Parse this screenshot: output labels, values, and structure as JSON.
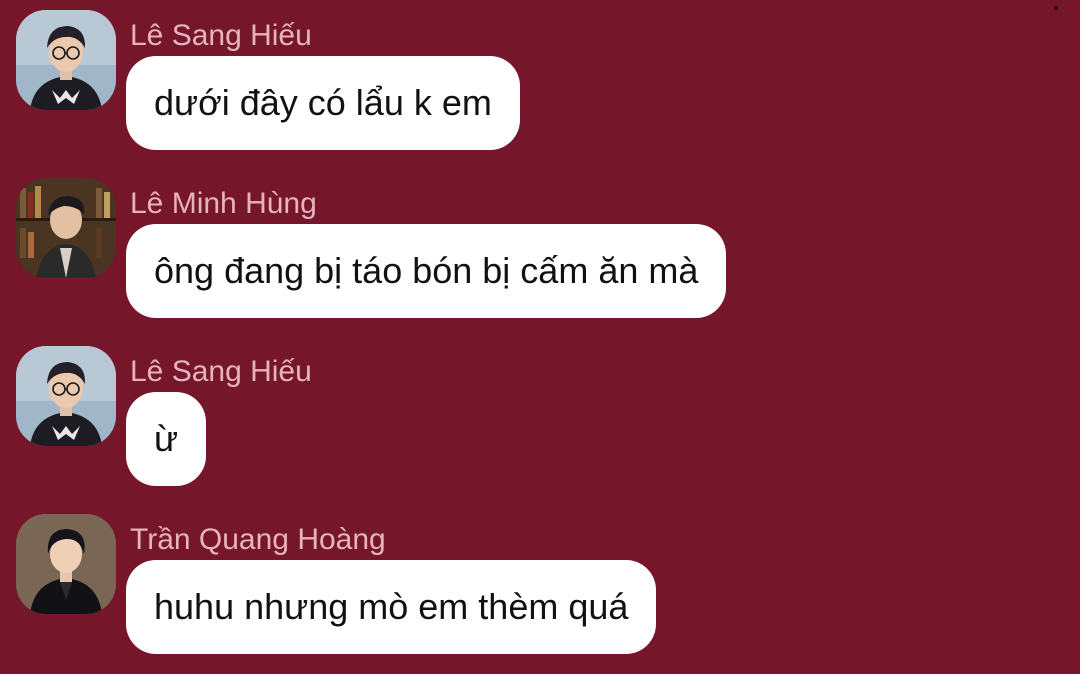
{
  "theme": {
    "background": "#75162a",
    "bubble": "#ffffff",
    "sender_color": "#e6b3bd",
    "text_color": "#111111"
  },
  "messages": [
    {
      "sender": "Lê Sang Hiếu",
      "text": "dưới đây có lẩu k em",
      "avatar": "avatar-sweater-glasses"
    },
    {
      "sender": "Lê Minh Hùng",
      "text": "ông đang bị táo bón bị cấm ăn mà",
      "avatar": "avatar-bookshelf"
    },
    {
      "sender": "Lê Sang Hiếu",
      "text": "ừ",
      "avatar": "avatar-sweater-glasses"
    },
    {
      "sender": "Trần Quang Hoàng",
      "text": "huhu nhưng mò em thèm quá",
      "avatar": "avatar-dark-jacket"
    }
  ]
}
